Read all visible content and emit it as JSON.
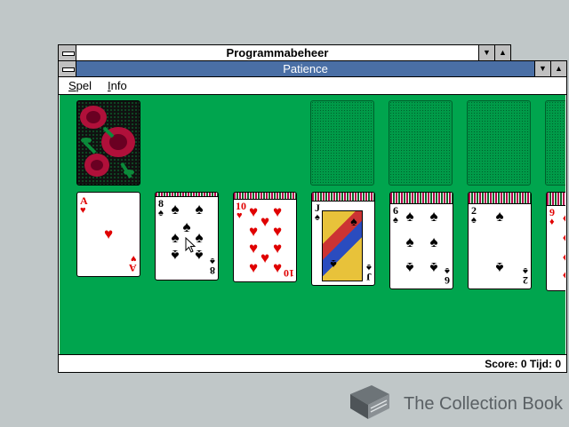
{
  "background_window": {
    "title": "Programmabeheer"
  },
  "window": {
    "title": "Patience",
    "titlebar_color": "#4a6fa5",
    "table_color": "#00a54e",
    "menu": [
      {
        "label": "Spel",
        "accel": "S",
        "rest": "pel"
      },
      {
        "label": "Info",
        "accel": "I",
        "rest": "nfo"
      }
    ],
    "status": "Score: 0 Tijd: 0"
  },
  "stock": {
    "card_back": "rose-pattern",
    "face_down": true
  },
  "foundations": [
    {
      "empty": true
    },
    {
      "empty": true
    },
    {
      "empty": true
    },
    {
      "empty": true
    }
  ],
  "tableau": [
    {
      "rank": "A",
      "suit": "hearts",
      "symbol": "♥",
      "color": "#e00000"
    },
    {
      "rank": "8",
      "suit": "spades",
      "symbol": "♠",
      "color": "#000000"
    },
    {
      "rank": "10",
      "suit": "hearts",
      "symbol": "♥",
      "color": "#e00000"
    },
    {
      "rank": "J",
      "suit": "spades",
      "symbol": "♠",
      "color": "#000000"
    },
    {
      "rank": "6",
      "suit": "spades",
      "symbol": "♠",
      "color": "#000000"
    },
    {
      "rank": "2",
      "suit": "spades",
      "symbol": "♠",
      "color": "#000000"
    },
    {
      "rank": "9",
      "suit": "diamonds",
      "symbol": "♦",
      "color": "#e00000"
    }
  ],
  "watermark": {
    "text": "The Collection Book",
    "icon": "book-icon"
  }
}
